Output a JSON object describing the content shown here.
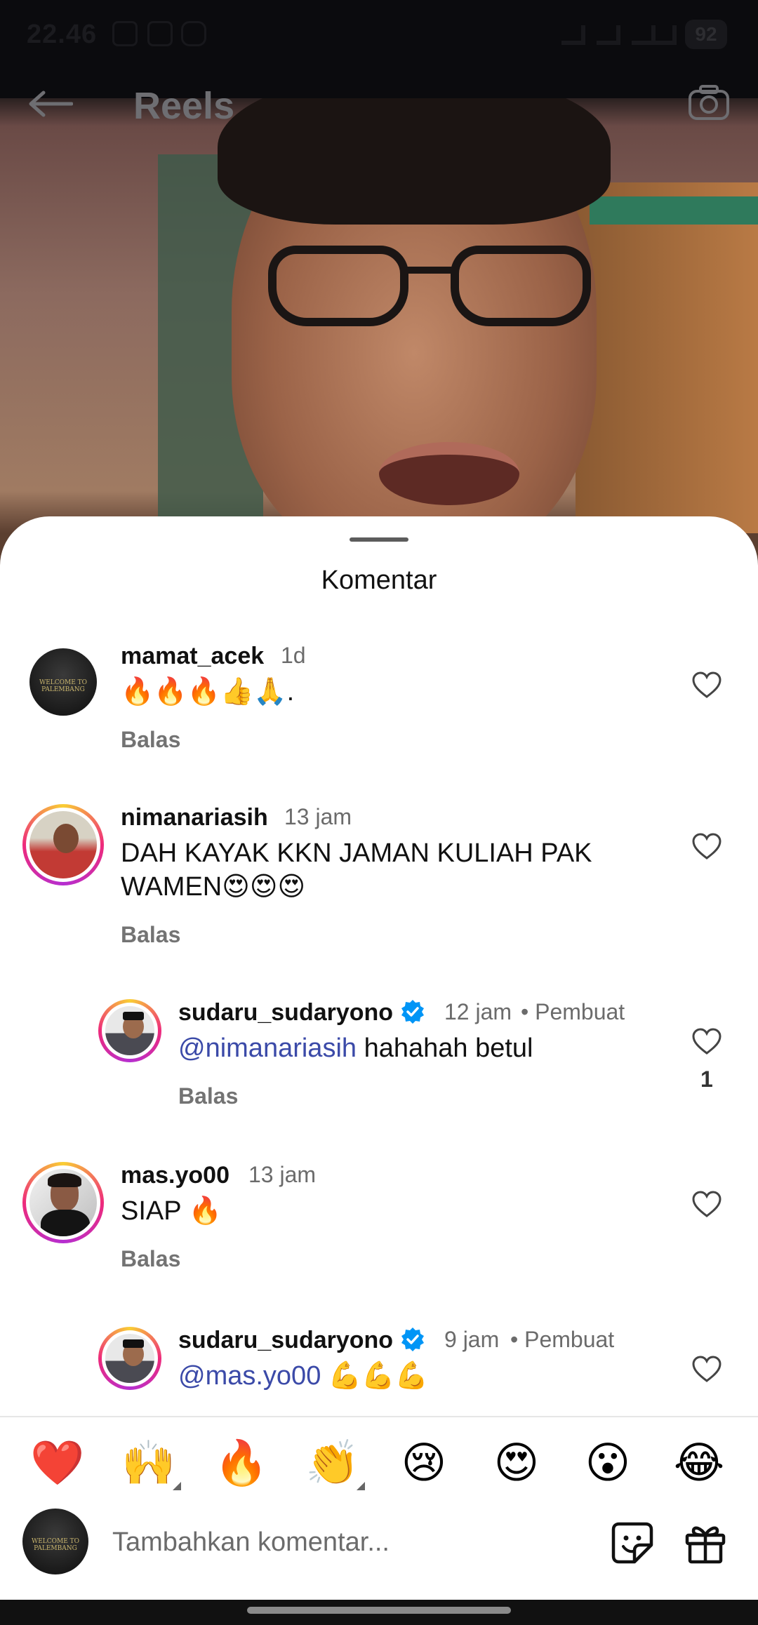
{
  "status_bar": {
    "time": "22.46",
    "battery": "92"
  },
  "header": {
    "title": "Reels"
  },
  "sheet": {
    "title": "Komentar"
  },
  "comments": [
    {
      "username": "mamat_acek",
      "time": "1d",
      "text": "🔥🔥🔥👍🙏.",
      "reply": "Balas"
    },
    {
      "username": "nimanariasih",
      "time": "13 jam",
      "text_line1": "DAH KAYAK KKN JAMAN KULIAH PAK",
      "text_line2": "WAMEN😍😍😍",
      "reply": "Balas"
    },
    {
      "username": "sudaru_sudaryono",
      "time": "12 jam",
      "creator": "• Pembuat",
      "mention": "@nimanariasih",
      "text": " hahahah betul",
      "reply": "Balas",
      "likes": "1"
    },
    {
      "username": "mas.yo00",
      "time": "13 jam",
      "text": "SIAP 🔥",
      "reply": "Balas"
    },
    {
      "username": "sudaru_sudaryono",
      "time": "9 jam",
      "creator": "• Pembuat",
      "mention": "@mas.yo00",
      "text": " 💪💪💪"
    }
  ],
  "reactions": [
    "❤️",
    "🙌",
    "🔥",
    "👏",
    "😢",
    "😍",
    "😮",
    "😂"
  ],
  "composer": {
    "placeholder": "Tambahkan komentar...",
    "avatar_label": "WELCOME TO PALEMBANG"
  },
  "colors": {
    "accent": "#0095f6",
    "mention": "#3b4aa8"
  }
}
